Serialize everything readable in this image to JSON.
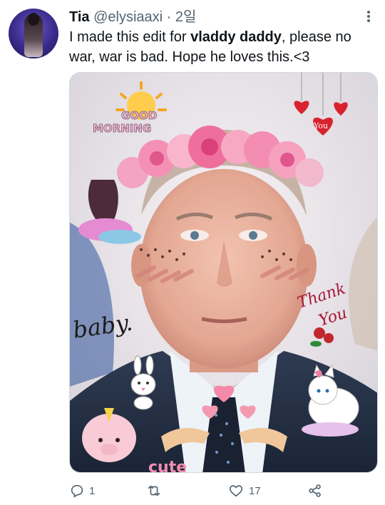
{
  "tweet": {
    "display_name": "Tia",
    "handle": "@elysiaaxi",
    "separator": " · ",
    "time": "2일",
    "text_before": "I made this edit for ",
    "text_bold": "vladdy daddy",
    "text_after": ", please no war, war is bad. Hope he loves this.<3"
  },
  "media": {
    "stickers": {
      "good_morning_line1": "GOOD",
      "good_morning_line2": "MORNING",
      "heart_you": "You",
      "thank_you_line1": "Thank",
      "thank_you_line2": "You",
      "baby": "baby.",
      "cute": "cute"
    }
  },
  "actions": {
    "reply_count": "1",
    "retweet_count": "",
    "like_count": "17"
  },
  "colors": {
    "accent_text": "#0f1419",
    "secondary_text": "#536471",
    "border": "#cfd9de"
  }
}
